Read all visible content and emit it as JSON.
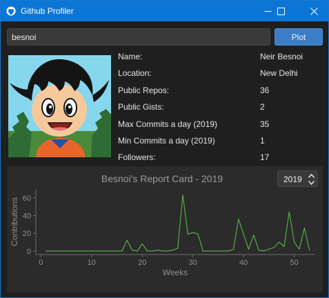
{
  "window": {
    "title": "Github Profiler",
    "accent": "#0c76d6"
  },
  "search": {
    "value": "besnoi",
    "placeholder": ""
  },
  "plot_button": {
    "label": "Plot"
  },
  "profile": {
    "rows": [
      {
        "label": "Name:",
        "value": "Neir Besnoi"
      },
      {
        "label": "Location:",
        "value": "New Delhi"
      },
      {
        "label": "Public Repos:",
        "value": "36"
      },
      {
        "label": "Public Gists:",
        "value": "2"
      },
      {
        "label": "Max Commits a day (2019)",
        "value": "35"
      },
      {
        "label": "Min Commits a day (2019)",
        "value": "1"
      },
      {
        "label": "Followers:",
        "value": "17"
      }
    ]
  },
  "year_selector": {
    "value": "2019"
  },
  "chart_data": {
    "type": "line",
    "title": "Besnoi's Report Card - 2019",
    "xlabel": "Weeks",
    "ylabel": "Contributions",
    "xlim": [
      -1,
      54
    ],
    "ylim": [
      -4,
      70
    ],
    "xticks": [
      0,
      10,
      20,
      30,
      40,
      50
    ],
    "yticks": [
      0,
      20,
      40,
      60
    ],
    "grid": false,
    "line_color": "#5ec44b",
    "x": [
      1,
      2,
      3,
      4,
      5,
      6,
      7,
      8,
      9,
      10,
      11,
      12,
      13,
      14,
      15,
      16,
      17,
      18,
      19,
      20,
      21,
      22,
      23,
      24,
      25,
      26,
      27,
      28,
      29,
      30,
      31,
      32,
      33,
      34,
      35,
      36,
      37,
      38,
      39,
      40,
      41,
      42,
      43,
      44,
      45,
      46,
      47,
      48,
      49,
      50,
      51,
      52,
      53
    ],
    "values": [
      0,
      0,
      0,
      0,
      0,
      0,
      0,
      0,
      0,
      0,
      0,
      0,
      0,
      0,
      0,
      0,
      12,
      1,
      0,
      8,
      0,
      0,
      1,
      0,
      0,
      1,
      3,
      63,
      19,
      21,
      19,
      0,
      0,
      0,
      0,
      0,
      0,
      2,
      36,
      19,
      2,
      18,
      1,
      0,
      2,
      4,
      10,
      5,
      44,
      10,
      2,
      26,
      1
    ]
  }
}
